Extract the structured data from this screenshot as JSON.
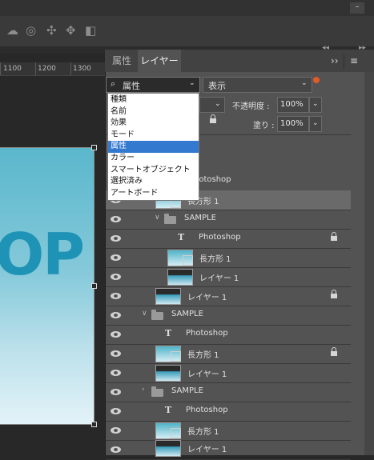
{
  "ruler": {
    "labels": [
      "1100",
      "1200",
      "1300"
    ]
  },
  "canvas": {
    "artboard_text": "OP"
  },
  "panel": {
    "tabs": [
      {
        "label": "属性"
      },
      {
        "label": "レイヤー"
      }
    ],
    "menu_expand": "››",
    "menu_icon": "≡",
    "filter": {
      "selected": "属性",
      "options": [
        "種類",
        "名前",
        "効果",
        "モード",
        "属性",
        "カラー",
        "スマートオブジェクト",
        "選択済み",
        "アートボード"
      ]
    },
    "mode_value": "表示",
    "opacity": {
      "label": "不透明度 :",
      "value": "100%"
    },
    "fill": {
      "label": "塗り :",
      "value": "100%"
    },
    "layers": [
      {
        "name": "hotoshop"
      },
      {
        "name": "長方形 1"
      },
      {
        "name": "SAMPLE"
      },
      {
        "name": "Photoshop"
      },
      {
        "name": "長方形 1"
      },
      {
        "name": "レイヤー 1"
      },
      {
        "name": "レイヤー 1"
      },
      {
        "name": "SAMPLE"
      },
      {
        "name": "Photoshop"
      },
      {
        "name": "長方形 1"
      },
      {
        "name": "レイヤー 1"
      },
      {
        "name": "SAMPLE"
      },
      {
        "name": "Photoshop"
      },
      {
        "name": "長方形 1"
      },
      {
        "name": "レイヤー 1"
      }
    ]
  },
  "icons": {
    "cloud": "cloud-icon",
    "lens": "target-icon",
    "move": "pan-icon",
    "video": "video-icon",
    "type": "type-layer-icon",
    "lock": "lock-icon"
  }
}
